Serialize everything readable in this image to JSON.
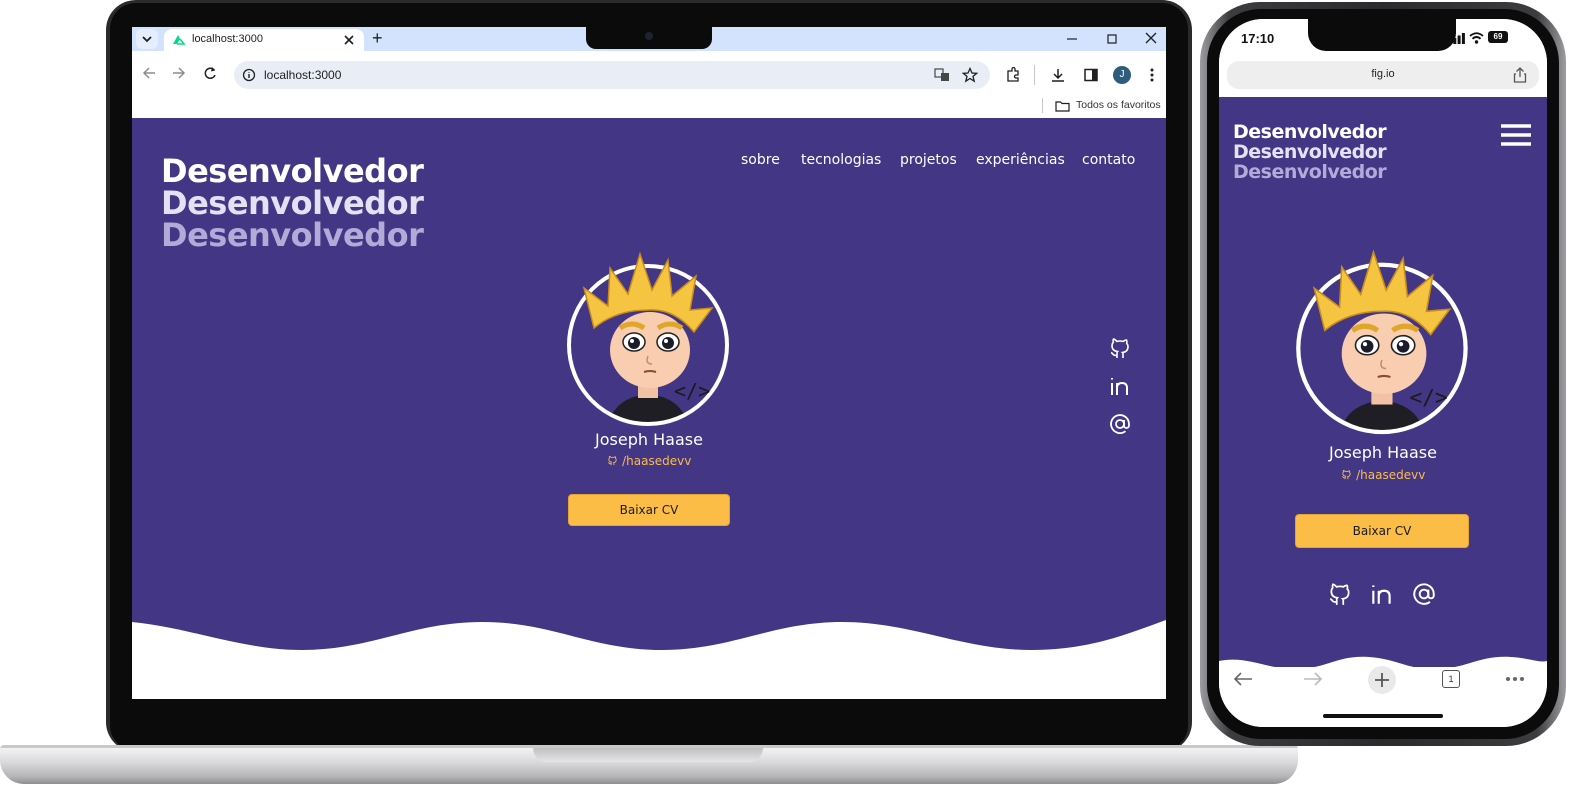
{
  "browser": {
    "tab_title": "localhost:3000",
    "url": "localhost:3000",
    "bookmark_folder": "Todos os favoritos",
    "profile_initial": "J",
    "new_tab_symbol": "+"
  },
  "site": {
    "hero_words": [
      "Desenvolvedor",
      "Desenvolvedor",
      "Desenvolvedor"
    ],
    "nav": [
      "sobre",
      "tecnologias",
      "projetos",
      "experiências",
      "contato"
    ],
    "name": "Joseph Haase",
    "handle": "/haasedevv",
    "cv_button": "Baixar CV",
    "social_icons": [
      "github-icon",
      "linkedin-icon",
      "at-icon"
    ]
  },
  "phone": {
    "time": "17:10",
    "battery": "69",
    "url": "fig.io",
    "tab_count": "1"
  },
  "colors": {
    "brand_purple": "#423685",
    "button_yellow": "#fbbd46",
    "chrome_tabstrip": "#d3e3fd"
  }
}
